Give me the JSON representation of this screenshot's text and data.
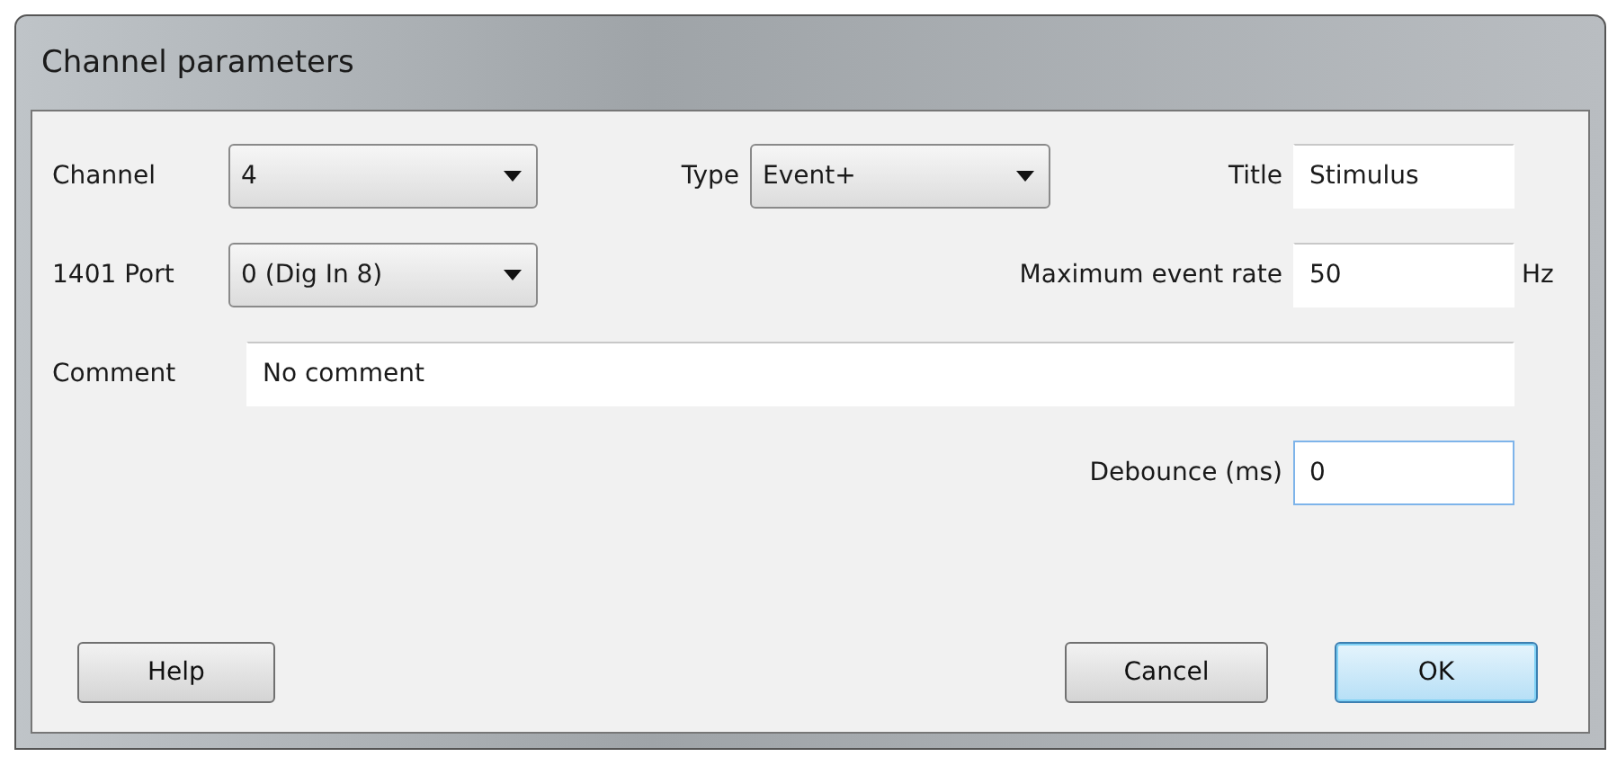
{
  "window": {
    "title": "Channel parameters"
  },
  "channel": {
    "label": "Channel",
    "value": "4"
  },
  "type": {
    "label": "Type",
    "value": "Event+"
  },
  "title_field": {
    "label": "Title",
    "value": "Stimulus"
  },
  "port": {
    "label": "1401 Port",
    "value": "0 (Dig In 8)"
  },
  "max_event_rate": {
    "label": "Maximum event rate",
    "value": "50",
    "unit": "Hz"
  },
  "comment": {
    "label": "Comment",
    "value": "No comment"
  },
  "debounce": {
    "label": "Debounce (ms)",
    "value": "0",
    "focused": true
  },
  "buttons": [
    {
      "label": "Help",
      "default": false
    },
    {
      "label": "Cancel",
      "default": false
    },
    {
      "label": "OK",
      "default": true
    }
  ]
}
